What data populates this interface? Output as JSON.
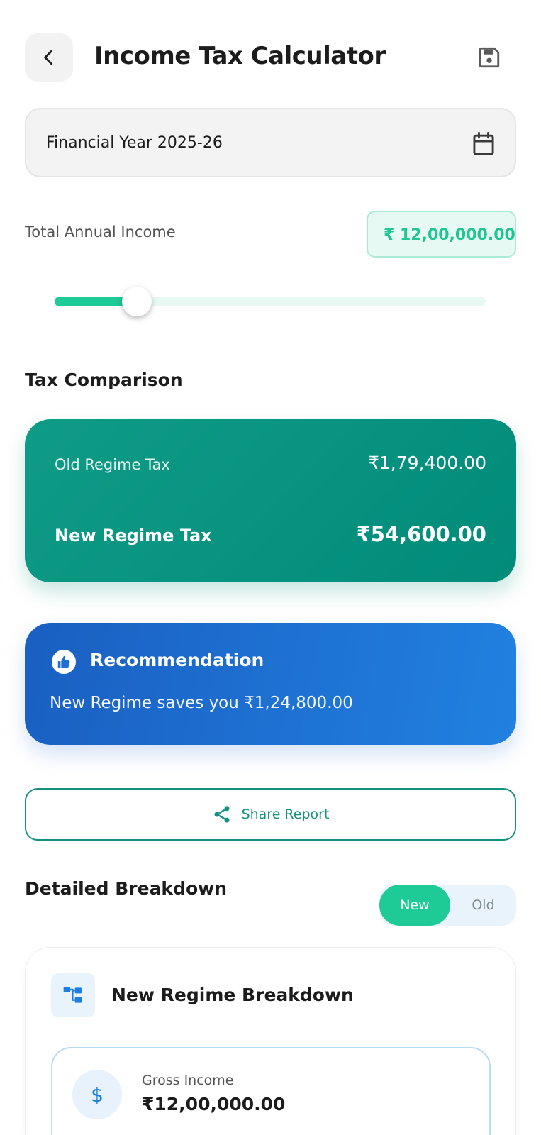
{
  "header": {
    "title": "Income Tax Calculator",
    "back_icon": "chevron-left-icon",
    "save_icon": "floppy-disk-icon"
  },
  "financial_year": {
    "value": "Financial Year 2025-26",
    "icon": "calendar-icon"
  },
  "income": {
    "label": "Total Annual Income",
    "value": "₹ 12,00,000.00",
    "slider_fraction": 0.19
  },
  "comparison": {
    "title": "Tax Comparison",
    "old_label": "Old Regime Tax",
    "old_value": "₹1,79,400.00",
    "new_label": "New Regime Tax",
    "new_value": "₹54,600.00"
  },
  "recommendation": {
    "icon": "thumbs-up-icon",
    "title": "Recommendation",
    "text": "New Regime saves you ₹1,24,800.00"
  },
  "share": {
    "icon": "share-icon",
    "label": "Share Report"
  },
  "breakdown": {
    "title": "Detailed Breakdown",
    "toggle": {
      "new": "New",
      "old": "Old",
      "selected": "New"
    },
    "card_icon": "hierarchy-icon",
    "card_title": "New Regime Breakdown",
    "gross_icon": "dollar-icon",
    "gross_label": "Gross Income",
    "gross_value": "₹12,00,000.00"
  },
  "colors": {
    "accent_green": "#1ecb96",
    "teal": "#00897b",
    "blue": "#1e6fd6",
    "share_teal": "#14927f"
  }
}
